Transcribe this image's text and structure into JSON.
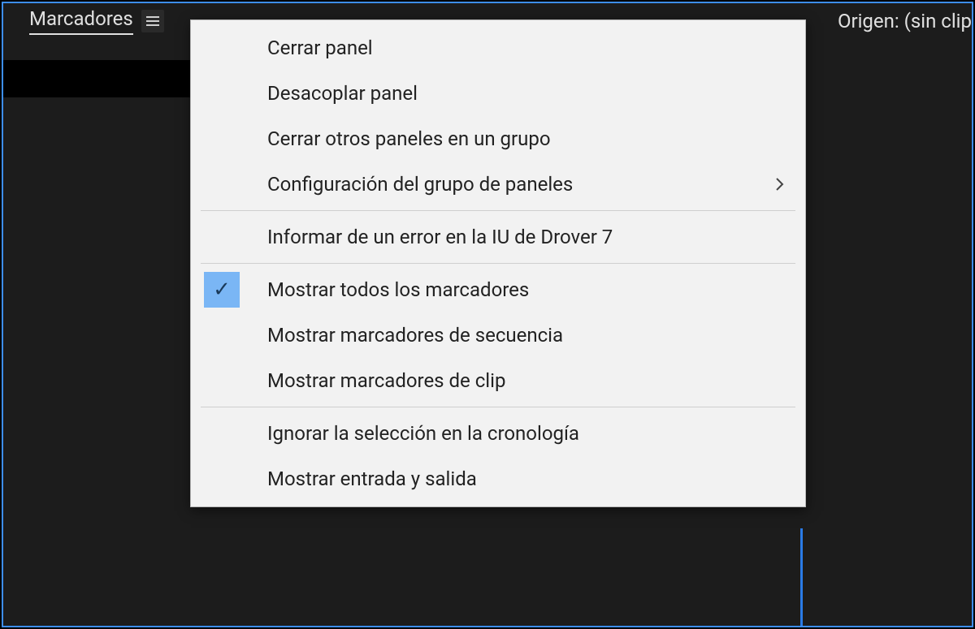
{
  "panel": {
    "tab_title": "Marcadores"
  },
  "right_panel": {
    "label": "Origen: (sin clip"
  },
  "menu": {
    "groups": [
      {
        "items": [
          {
            "label": "Cerrar panel",
            "checked": false,
            "submenu": false
          },
          {
            "label": "Desacoplar panel",
            "checked": false,
            "submenu": false
          },
          {
            "label": "Cerrar otros paneles en un grupo",
            "checked": false,
            "submenu": false
          },
          {
            "label": "Configuración del grupo de paneles",
            "checked": false,
            "submenu": true
          }
        ]
      },
      {
        "items": [
          {
            "label": "Informar de un error en la IU de Drover 7",
            "checked": false,
            "submenu": false
          }
        ]
      },
      {
        "items": [
          {
            "label": "Mostrar todos los marcadores",
            "checked": true,
            "submenu": false
          },
          {
            "label": "Mostrar marcadores de secuencia",
            "checked": false,
            "submenu": false
          },
          {
            "label": "Mostrar marcadores de clip",
            "checked": false,
            "submenu": false
          }
        ]
      },
      {
        "items": [
          {
            "label": "Ignorar la selección en la cronología",
            "checked": false,
            "submenu": false
          },
          {
            "label": "Mostrar entrada y salida",
            "checked": false,
            "submenu": false
          }
        ]
      }
    ]
  }
}
